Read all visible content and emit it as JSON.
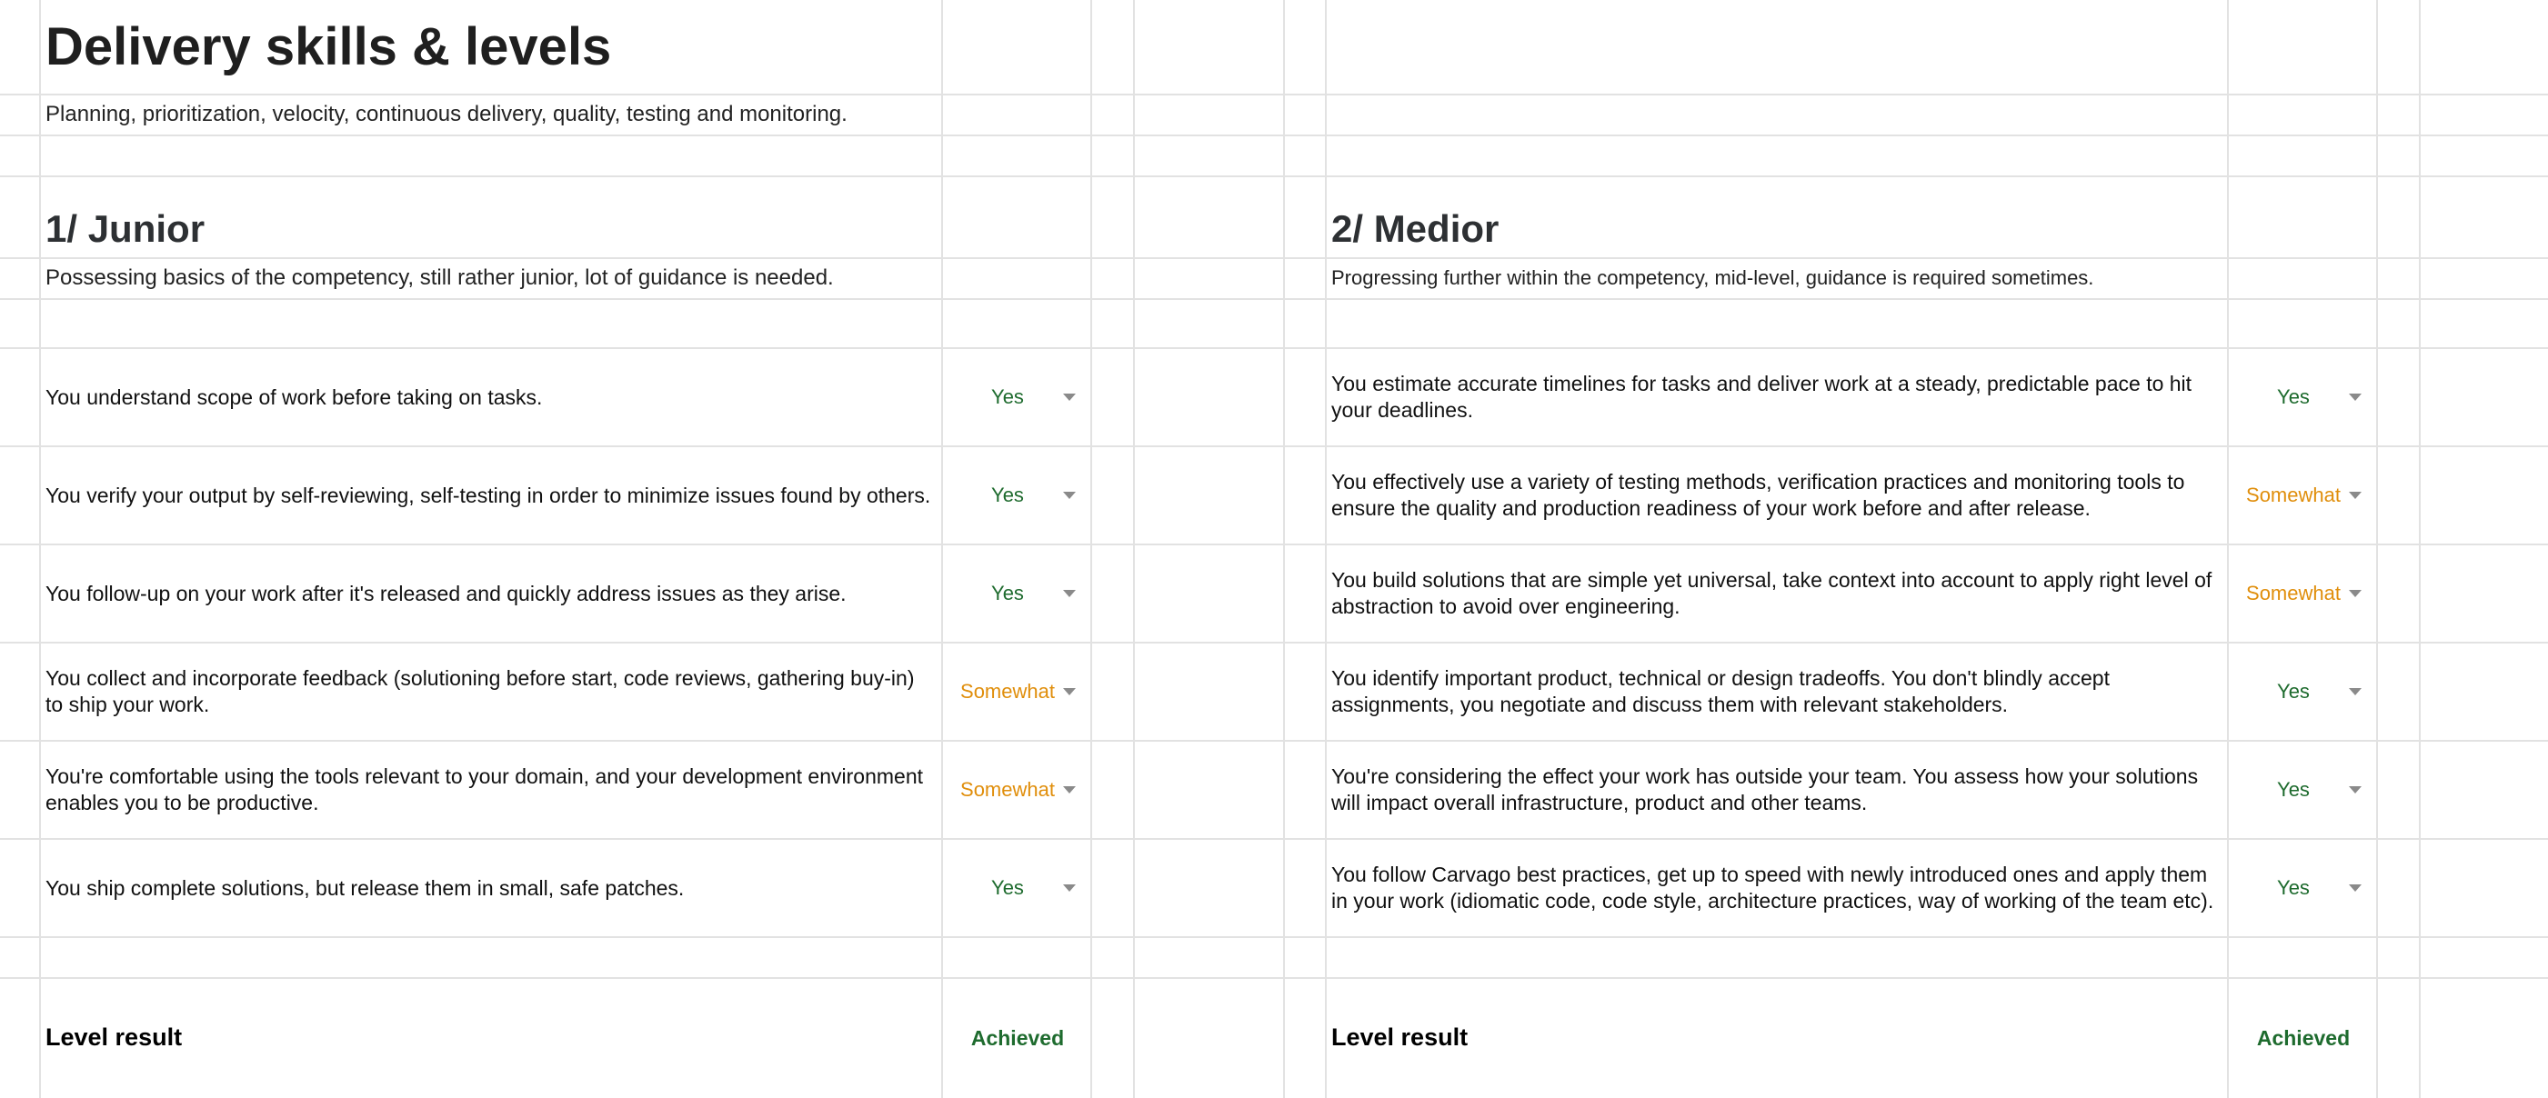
{
  "header": {
    "title": "Delivery skills & levels",
    "subtitle": "Planning, prioritization, velocity, continuous delivery, quality, testing and monitoring."
  },
  "colors": {
    "yes": "#1e6b2e",
    "somewhat": "#e08e0b",
    "gridline": "#e2e2e2"
  },
  "levels": [
    {
      "title": "1/ Junior",
      "description": "Possessing basics of the competency, still rather junior, lot of guidance is needed.",
      "items": [
        {
          "text": "You understand scope of work before taking on tasks.",
          "answer": "Yes"
        },
        {
          "text": "You verify your output by self-reviewing, self-testing in order to minimize issues found by others.",
          "answer": "Yes"
        },
        {
          "text": "You follow-up on your work after it's released and quickly address issues as they arise.",
          "answer": "Yes"
        },
        {
          "text": "You collect and incorporate feedback (solutioning before start, code reviews, gathering buy-in) to ship your work.",
          "answer": "Somewhat"
        },
        {
          "text": "You're comfortable using the tools relevant to your domain, and your development environment enables you to be productive.",
          "answer": "Somewhat"
        },
        {
          "text": "You ship complete solutions, but release them in small, safe patches.",
          "answer": "Yes"
        }
      ],
      "result_label": "Level result",
      "result_value": "Achieved"
    },
    {
      "title": "2/ Medior",
      "description": "Progressing further within the competency, mid-level, guidance is required sometimes.",
      "items": [
        {
          "text": "You estimate accurate timelines for tasks and deliver work at a steady, predictable pace to hit your deadlines.",
          "answer": "Yes"
        },
        {
          "text": "You effectively use a variety of testing methods, verification practices and monitoring tools to ensure the quality and production readiness of your work before and after release.",
          "answer": "Somewhat"
        },
        {
          "text": "You build solutions that are simple yet universal, take context into account to apply right level of abstraction to avoid over engineering.",
          "answer": "Somewhat"
        },
        {
          "text": "You identify important product, technical or design tradeoffs. You don't blindly accept assignments, you negotiate and discuss them with relevant stakeholders.",
          "answer": "Yes"
        },
        {
          "text": "You're considering the effect your work has outside your team. You assess how your solutions will impact overall infrastructure, product and other teams.",
          "answer": "Yes"
        },
        {
          "text": "You follow Carvago best practices, get up to speed with newly introduced ones and apply them in your work (idiomatic code, code style, architecture practices, way of working of the team etc).",
          "answer": "Yes"
        }
      ],
      "result_label": "Level result",
      "result_value": "Achieved"
    }
  ]
}
